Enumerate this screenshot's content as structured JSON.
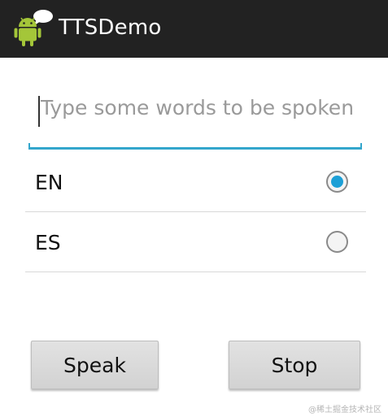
{
  "app": {
    "title": "TTSDemo",
    "icon": "android-robot-speech-icon"
  },
  "input": {
    "value": "",
    "placeholder": "Type some words to be spoken",
    "accent_color": "#33a6cc"
  },
  "languages": {
    "options": [
      {
        "label": "EN",
        "selected": true
      },
      {
        "label": "ES",
        "selected": false
      }
    ],
    "selected_color": "#1c9fd6"
  },
  "buttons": {
    "speak_label": "Speak",
    "stop_label": "Stop"
  },
  "watermark": "@稀土掘金技术社区"
}
